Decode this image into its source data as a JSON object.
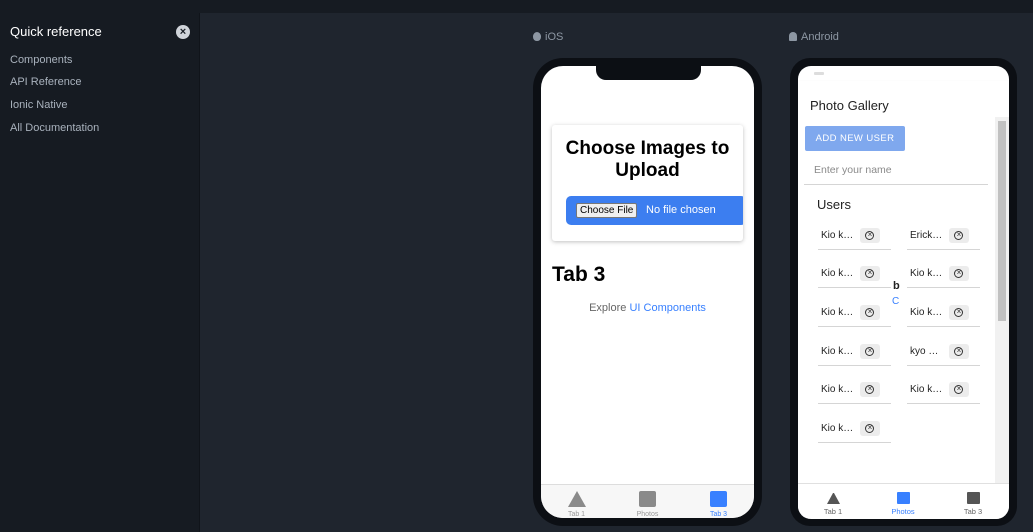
{
  "sidebar": {
    "title": "Quick reference",
    "close_icon": "close-circle-icon",
    "links": [
      "Components",
      "API Reference",
      "Ionic Native",
      "All Documentation"
    ]
  },
  "platforms": {
    "ios_label": "iOS",
    "android_label": "Android"
  },
  "ios": {
    "upload_title": "Choose Images to Upload",
    "file_button": "Choose File",
    "file_status": "No file chosen",
    "page_title": "Tab 3",
    "explore_prefix": "Explore",
    "explore_link": "UI Components",
    "tabs": [
      {
        "label": "Tab 1",
        "icon": "triangle-icon"
      },
      {
        "label": "Photos",
        "icon": "images-icon"
      },
      {
        "label": "Tab 3",
        "icon": "square-icon"
      }
    ],
    "active_tab": "Tab 3"
  },
  "android": {
    "toolbar_title": "Photo Gallery",
    "add_user_button": "ADD NEW USER",
    "name_placeholder": "Enter your name",
    "users_heading": "Users",
    "users": [
      "Kio k…",
      "Erick…",
      "Kio k…",
      "Kio k…",
      "Kio k…",
      "Kio k…",
      "Kio k…",
      "kyo …",
      "Kio k…",
      "Kio k…",
      "Kio k…"
    ],
    "bleed_text_b": "b",
    "bleed_text_c": "C",
    "tabs": [
      {
        "label": "Tab 1",
        "icon": "triangle-icon"
      },
      {
        "label": "Photos",
        "icon": "images-icon"
      },
      {
        "label": "Tab 3",
        "icon": "square-icon"
      }
    ],
    "active_tab": "Photos"
  },
  "colors": {
    "accent": "#3880ff",
    "background": "#1f252e",
    "sidebar": "#161b22"
  }
}
